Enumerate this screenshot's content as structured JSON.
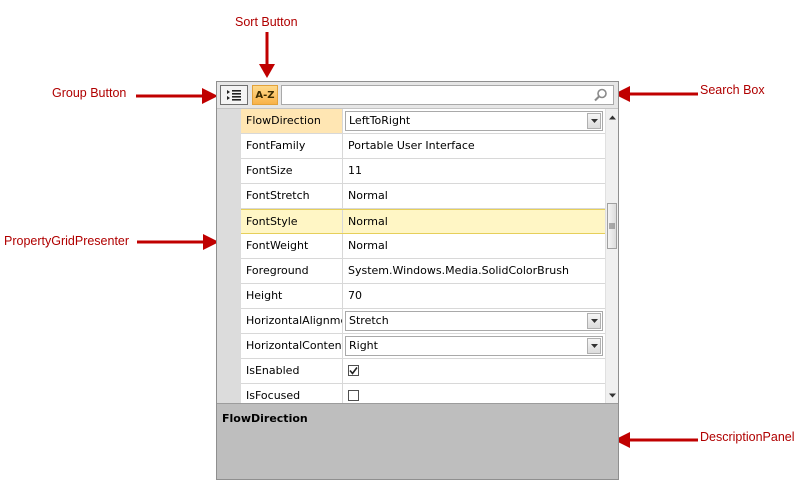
{
  "callouts": {
    "sort_button": "Sort Button",
    "group_button": "Group Button",
    "search_box": "Search Box",
    "presenter": "PropertyGridPresenter",
    "description_panel": "DescriptionPanel"
  },
  "toolbar": {
    "group_icon": "categorize-icon",
    "sort_label": "A-Z",
    "search_placeholder": "",
    "search_value": ""
  },
  "properties": [
    {
      "name": "FlowDirection",
      "value": "LeftToRight",
      "editor": "combo"
    },
    {
      "name": "FontFamily",
      "value": "Portable User Interface",
      "editor": "text"
    },
    {
      "name": "FontSize",
      "value": "11",
      "editor": "text"
    },
    {
      "name": "FontStretch",
      "value": "Normal",
      "editor": "text"
    },
    {
      "name": "FontStyle",
      "value": "Normal",
      "editor": "text"
    },
    {
      "name": "FontWeight",
      "value": "Normal",
      "editor": "text"
    },
    {
      "name": "Foreground",
      "value": "System.Windows.Media.SolidColorBrush",
      "editor": "text"
    },
    {
      "name": "Height",
      "value": "70",
      "editor": "text"
    },
    {
      "name": "HorizontalAlignment",
      "value": "Stretch",
      "editor": "combo"
    },
    {
      "name": "HorizontalContentAlignment",
      "value": "Right",
      "editor": "combo"
    },
    {
      "name": "IsEnabled",
      "value": true,
      "editor": "checkbox"
    },
    {
      "name": "IsFocused",
      "value": false,
      "editor": "checkbox"
    }
  ],
  "selected_property": "FlowDirection",
  "hovered_property": "FontStyle",
  "description": {
    "title": "FlowDirection"
  },
  "colors": {
    "callout_text": "#b00000",
    "arrow": "#c00000",
    "selected_name_bg": "#ffe6b3",
    "hover_row_bg": "#fff6c5",
    "description_bg": "#bebebe"
  }
}
